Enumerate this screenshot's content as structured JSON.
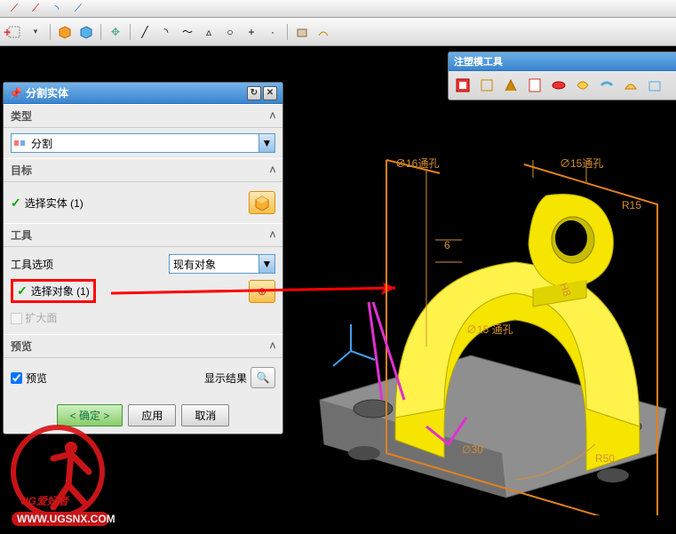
{
  "toolbars": {},
  "float_toolbar": {
    "title": "注塑模工具"
  },
  "dialog": {
    "title": "分割实体",
    "sections": {
      "type": {
        "label": "类型",
        "value": "分割"
      },
      "target": {
        "label": "目标",
        "select_body": "选择实体 (1)"
      },
      "tool": {
        "label": "工具",
        "option_label": "工具选项",
        "option_value": "现有对象",
        "select_object": "选择对象 (1)",
        "expand_face": "扩大面"
      },
      "preview": {
        "label": "预览",
        "checkbox": "预览",
        "show_result": "显示结果"
      }
    },
    "buttons": {
      "ok": "< 确定 >",
      "apply": "应用",
      "cancel": "取消"
    }
  },
  "annotations": {
    "dim1": "∅16通孔",
    "dim2": "∅15通孔",
    "r15": "R15",
    "six": "6",
    "h8": "H8",
    "dim15": "∅15 通孔",
    "r50": "R50",
    "d30": "∅30"
  },
  "watermark": {
    "text1": "UG爱好者",
    "text2": "WWW.UGSNX.COM"
  }
}
